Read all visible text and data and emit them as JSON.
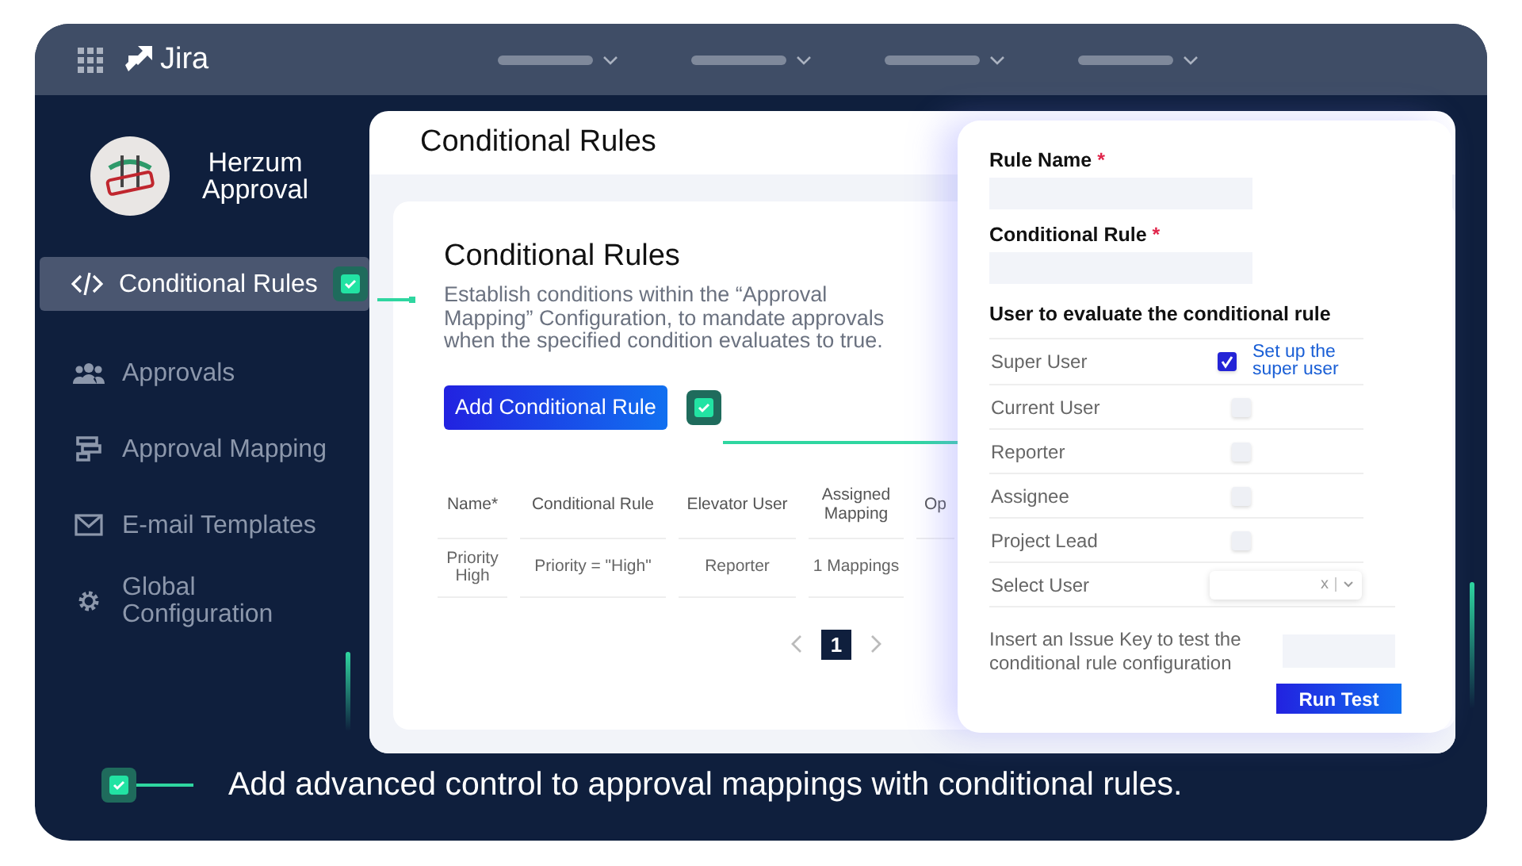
{
  "app": {
    "name": "Jira"
  },
  "brand": {
    "title": "Herzum Approval"
  },
  "sidebar": {
    "items": [
      {
        "label": "Conditional Rules",
        "kind": "code",
        "selected": true
      },
      {
        "label": "Approvals",
        "kind": "people",
        "selected": false
      },
      {
        "label": "Approval Mapping",
        "kind": "mapping",
        "selected": false
      },
      {
        "label": "E-mail Templates",
        "kind": "mail",
        "selected": false
      },
      {
        "label": "Global Configuration",
        "kind": "gear",
        "selected": false
      }
    ]
  },
  "page": {
    "title": "Conditional Rules"
  },
  "card": {
    "title": "Conditional Rules",
    "description": "Establish conditions within the “Approval Mapping” Configuration, to mandate approvals when the specified condition evaluates to true.",
    "add_button": "Add Conditional Rule"
  },
  "table": {
    "columns": [
      "Name*",
      "Conditional Rule",
      "Elevator User",
      "Assigned Mapping",
      "Op"
    ],
    "rows": [
      [
        "Priority High",
        "Priority  = \"High\"",
        "Reporter",
        "1 Mappings"
      ]
    ]
  },
  "pagination": {
    "pages": [
      {
        "label": "1",
        "selected": true
      }
    ]
  },
  "form": {
    "fields": [
      {
        "label": "Rule Name",
        "required_mark": "*"
      },
      {
        "label": "Conditional Rule",
        "required_mark": "*"
      }
    ],
    "users_heading": "User to evaluate the conditional  rule",
    "users": [
      {
        "label": "Super User",
        "kind": "checkbox",
        "checked": true,
        "link": "Set up the super user"
      },
      {
        "label": "Current User",
        "kind": "checkbox",
        "checked": false
      },
      {
        "label": "Reporter",
        "kind": "checkbox",
        "checked": false
      },
      {
        "label": "Assignee",
        "kind": "checkbox",
        "checked": false
      },
      {
        "label": "Project Lead",
        "kind": "checkbox",
        "checked": false
      },
      {
        "label": "Select User",
        "kind": "select",
        "clear": "x"
      }
    ],
    "test_label": "Insert an Issue Key to test the conditional rule configuration",
    "run_button": "Run Test"
  },
  "caption": "Add advanced control to approval mappings with conditional rules."
}
